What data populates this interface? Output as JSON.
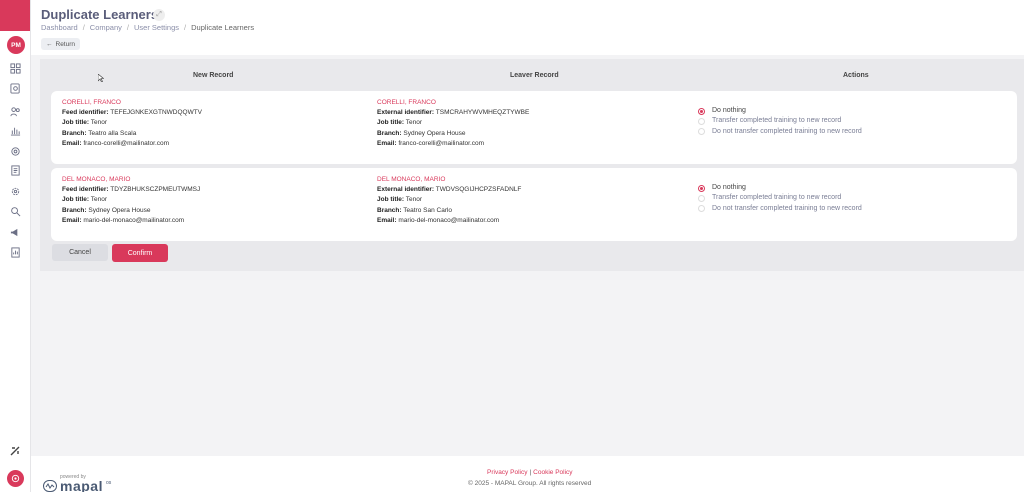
{
  "sidebar": {
    "avatar_initials": "PM",
    "icons": [
      "dashboard-icon",
      "search-doc-icon",
      "users-icon",
      "chart-icon",
      "settings-icon",
      "document-icon",
      "gear-icon",
      "search-icon",
      "megaphone-icon",
      "report-icon"
    ],
    "accent": "#d9395b"
  },
  "header": {
    "title": "Duplicate Learners",
    "breadcrumb": [
      "Dashboard",
      "Company",
      "User Settings",
      "Duplicate Learners"
    ],
    "return_label": "Return"
  },
  "table": {
    "columns": [
      "New Record",
      "Leaver Record",
      "Actions"
    ],
    "rows": [
      {
        "new": {
          "name": "CORELLI, FRANCO",
          "id_label": "Feed identifier:",
          "id_value": "TEFEJGNKEXGTNWDQQWTV",
          "job_label": "Job title:",
          "job_value": "Tenor",
          "branch_label": "Branch:",
          "branch_value": "Teatro alla Scala",
          "email_label": "Email:",
          "email_value": "franco-corelli@mailinator.com"
        },
        "leaver": {
          "name": "CORELLI, FRANCO",
          "id_label": "External identifier:",
          "id_value": "TSMCRAHYWVMHEQZTYWBE",
          "job_label": "Job title:",
          "job_value": "Tenor",
          "branch_label": "Branch:",
          "branch_value": "Sydney Opera House",
          "email_label": "Email:",
          "email_value": "franco-corelli@mailinator.com"
        },
        "actions": [
          "Do nothing",
          "Transfer completed training to new record",
          "Do not transfer completed training to new record"
        ],
        "selected": 0
      },
      {
        "new": {
          "name": "DEL MONACO, MARIO",
          "id_label": "Feed identifier:",
          "id_value": "TDYZBHUKSCZPMEUTWMSJ",
          "job_label": "Job title:",
          "job_value": "Tenor",
          "branch_label": "Branch:",
          "branch_value": "Sydney Opera House",
          "email_label": "Email:",
          "email_value": "mario-del-monaco@mailinator.com"
        },
        "leaver": {
          "name": "DEL MONACO, MARIO",
          "id_label": "External identifier:",
          "id_value": "TWDVSQGIJHCPZSFADNLF",
          "job_label": "Job title:",
          "job_value": "Tenor",
          "branch_label": "Branch:",
          "branch_value": "Teatro San Carlo",
          "email_label": "Email:",
          "email_value": "mario-del-monaco@mailinator.com"
        },
        "actions": [
          "Do nothing",
          "Transfer completed training to new record",
          "Do not transfer completed training to new record"
        ],
        "selected": 0
      }
    ]
  },
  "buttons": {
    "cancel": "Cancel",
    "confirm": "Confirm"
  },
  "footer": {
    "powered_by": "powered by",
    "brand": "mapal",
    "brand_suffix": "os",
    "privacy": "Privacy Policy",
    "separator": "|",
    "cookie": "Cookie Policy",
    "copyright": "© 2025 - MAPAL Group. All rights reserved"
  }
}
